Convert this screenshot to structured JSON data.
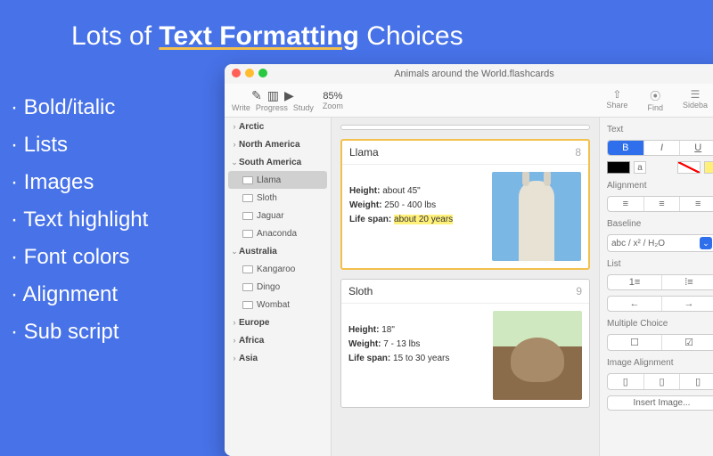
{
  "promo": {
    "headline_pre": "Lots of ",
    "headline_em": "Text Formatting",
    "headline_post": " Choices",
    "bullets": [
      "Bold/italic",
      "Lists",
      "Images",
      "Text highlight",
      "Font colors",
      "Alignment",
      "Sub script"
    ]
  },
  "window": {
    "title": "Animals around the World.flashcards",
    "toolbar": {
      "write": "Write",
      "progress": "Progress",
      "study": "Study",
      "zoom_value": "85%",
      "zoom_label": "Zoom",
      "share": "Share",
      "find": "Find",
      "sidebar": "Sideba"
    }
  },
  "sidebar": {
    "regions": [
      {
        "name": "Arctic",
        "expanded": false
      },
      {
        "name": "North America",
        "expanded": false
      },
      {
        "name": "South America",
        "expanded": true,
        "items": [
          "Llama",
          "Sloth",
          "Jaguar",
          "Anaconda"
        ],
        "selected": "Llama"
      },
      {
        "name": "Australia",
        "expanded": true,
        "items": [
          "Kangaroo",
          "Dingo",
          "Wombat"
        ]
      },
      {
        "name": "Europe",
        "expanded": false
      },
      {
        "name": "Africa",
        "expanded": false
      },
      {
        "name": "Asia",
        "expanded": false
      }
    ]
  },
  "cards": [
    {
      "title": "Llama",
      "number": "8",
      "facts": [
        {
          "label": "Height:",
          "value": "about 45\"",
          "hl": false
        },
        {
          "label": "Weight:",
          "value": "250 - 400 lbs",
          "hl": false
        },
        {
          "label": "Life span:",
          "value": "about 20 years",
          "hl": true
        }
      ]
    },
    {
      "title": "Sloth",
      "number": "9",
      "facts": [
        {
          "label": "Height:",
          "value": "18\"",
          "hl": false
        },
        {
          "label": "Weight:",
          "value": "7 - 13 lbs",
          "hl": false
        },
        {
          "label": "Life span:",
          "value": "15 to 30 years",
          "hl": false
        }
      ]
    }
  ],
  "inspector": {
    "text_label": "Text",
    "bold": "B",
    "italic": "I",
    "underline": "U",
    "alignment_label": "Alignment",
    "baseline_label": "Baseline",
    "baseline_value": "abc / x² / H₂O",
    "list_label": "List",
    "list_numbered": "1≡",
    "list_bulleted": "⁞≡",
    "indent_out": "←",
    "indent_in": "→",
    "mc_label": "Multiple Choice",
    "img_align_label": "Image Alignment",
    "insert_image": "Insert Image..."
  }
}
